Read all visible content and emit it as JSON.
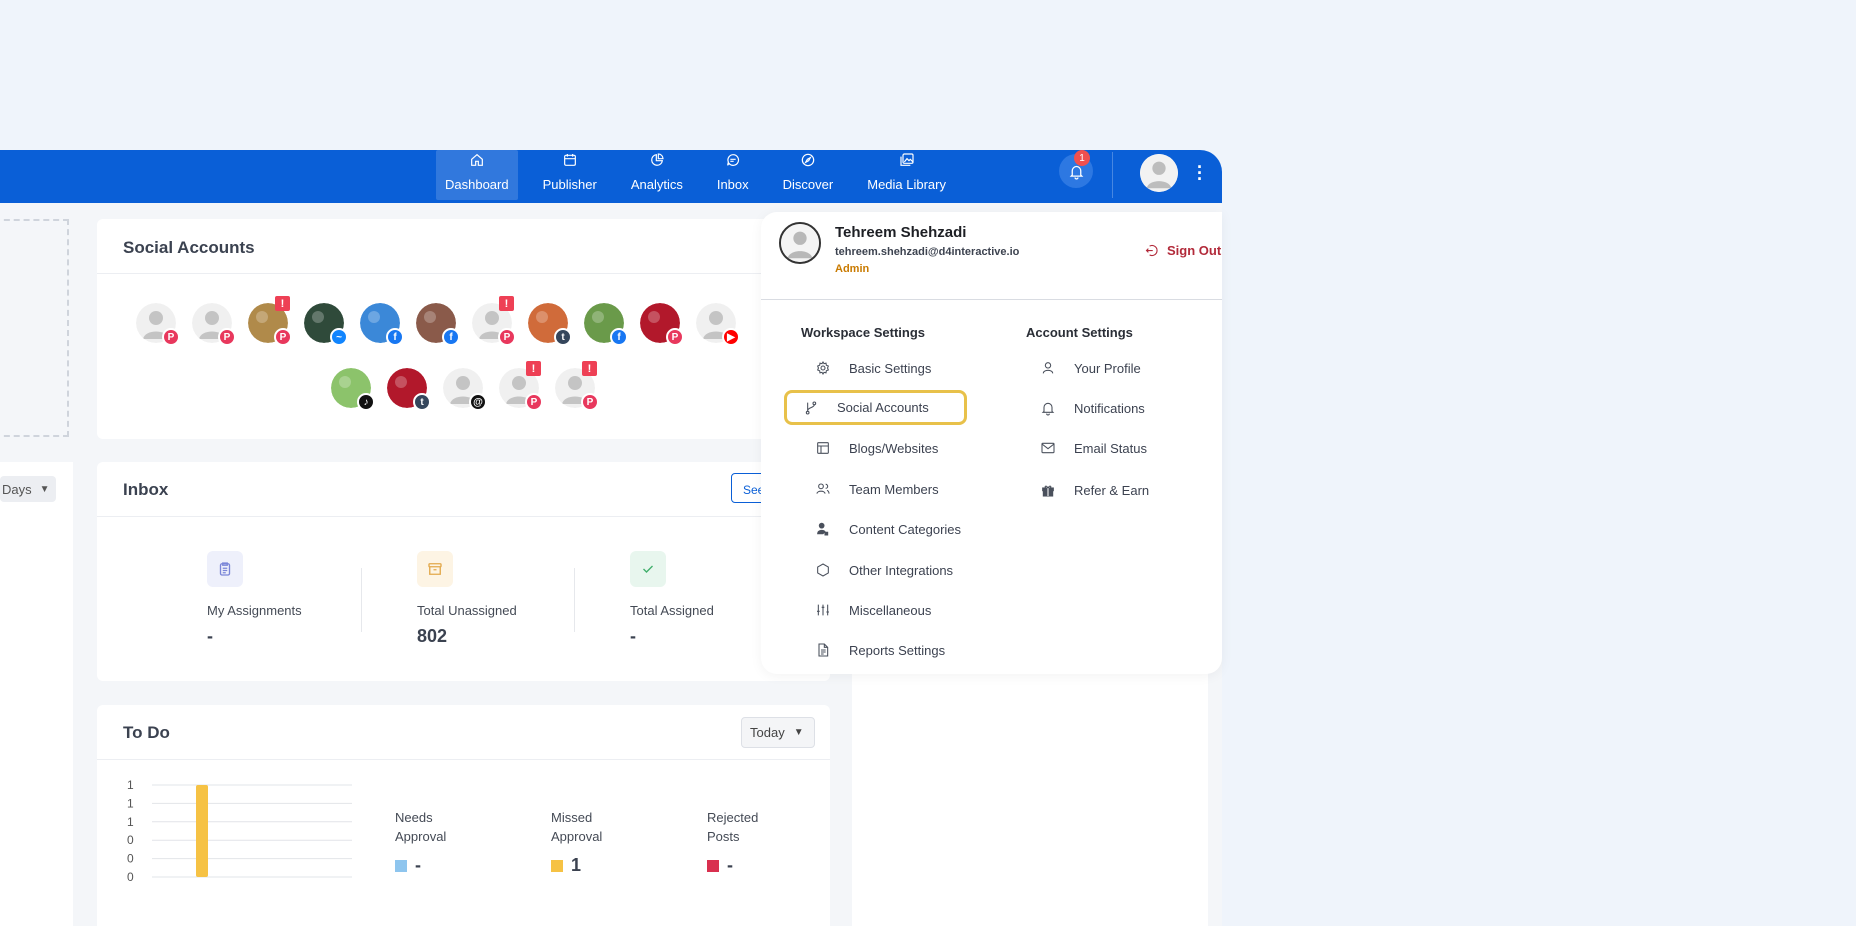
{
  "nav": {
    "items": [
      {
        "label": "Dashboard",
        "icon": "home-icon",
        "active": true
      },
      {
        "label": "Publisher",
        "icon": "calendar-icon"
      },
      {
        "label": "Analytics",
        "icon": "pie-chart-icon"
      },
      {
        "label": "Inbox",
        "icon": "chat-icon"
      },
      {
        "label": "Discover",
        "icon": "compass-icon"
      },
      {
        "label": "Media Library",
        "icon": "images-icon"
      }
    ],
    "notifications_count": "1"
  },
  "left": {
    "days_label": "Days"
  },
  "social_accounts": {
    "title": "Social Accounts"
  },
  "inbox": {
    "title": "Inbox",
    "see_label": "See",
    "stats": [
      {
        "label": "My Assignments",
        "value": "-"
      },
      {
        "label": "Total Unassigned",
        "value": "802"
      },
      {
        "label": "Total Assigned",
        "value": "-"
      }
    ]
  },
  "todo": {
    "title": "To Do",
    "filter": "Today",
    "legend": [
      {
        "line1": "Needs",
        "line2": "Approval",
        "value": "-",
        "color": "#8ec5ee"
      },
      {
        "line1": "Missed",
        "line2": "Approval",
        "value": "1",
        "color": "#f6c244"
      },
      {
        "line1": "Rejected",
        "line2": "Posts",
        "value": "-",
        "color": "#d9304f"
      }
    ]
  },
  "chart_data": {
    "type": "bar",
    "categories": [
      ""
    ],
    "series": [
      {
        "values": [
          1
        ]
      }
    ],
    "yticks": [
      "1",
      "1",
      "1",
      "0",
      "0",
      "0"
    ],
    "ylim": [
      0,
      1
    ],
    "bar_color": "#f6c244"
  },
  "profile": {
    "name": "Tehreem Shehzadi",
    "email": "tehreem.shehzadi@d4interactive.io",
    "role": "Admin",
    "sign_out": "Sign Out"
  },
  "workspace_settings": {
    "title": "Workspace Settings",
    "items": [
      {
        "label": "Basic Settings",
        "icon": "gear-icon"
      },
      {
        "label": "Social Accounts",
        "icon": "branch-icon",
        "highlighted": true
      },
      {
        "label": "Blogs/Websites",
        "icon": "layout-icon"
      },
      {
        "label": "Team Members",
        "icon": "users-icon"
      },
      {
        "label": "Content Categories",
        "icon": "user-tag-icon"
      },
      {
        "label": "Other Integrations",
        "icon": "hexagon-icon"
      },
      {
        "label": "Miscellaneous",
        "icon": "sliders-icon"
      },
      {
        "label": "Reports Settings",
        "icon": "file-icon"
      }
    ]
  },
  "account_settings": {
    "title": "Account Settings",
    "items": [
      {
        "label": "Your Profile",
        "icon": "user-icon"
      },
      {
        "label": "Notifications",
        "icon": "bell-icon"
      },
      {
        "label": "Email Status",
        "icon": "mail-icon"
      },
      {
        "label": "Refer & Earn",
        "icon": "gift-icon"
      }
    ]
  }
}
